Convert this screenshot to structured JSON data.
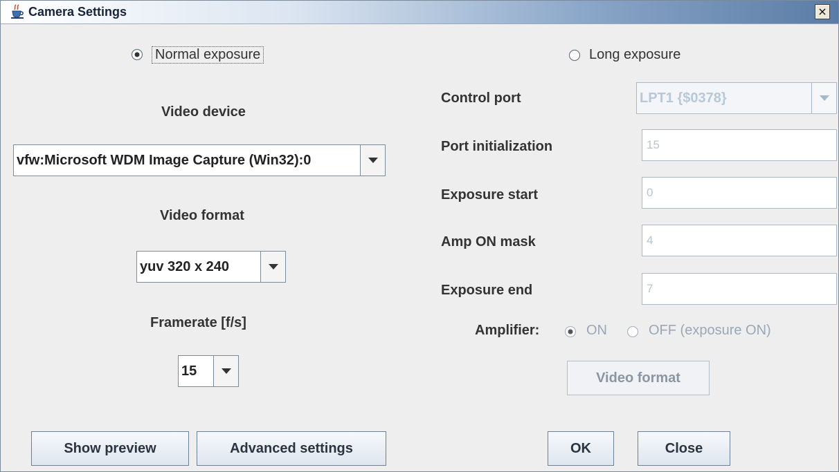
{
  "window": {
    "title": "Camera Settings",
    "close_glyph": "×",
    "icon": "java-cup-icon"
  },
  "exposure": {
    "normal_label": "Normal exposure",
    "long_label": "Long exposure",
    "selected": "normal"
  },
  "left": {
    "video_device_label": "Video device",
    "video_device_value": "vfw:Microsoft WDM Image Capture (Win32):0",
    "video_format_label": "Video format",
    "video_format_value": "yuv 320 x 240",
    "framerate_label": "Framerate [f/s]",
    "framerate_value": "15"
  },
  "right": {
    "control_port_label": "Control port",
    "control_port_value": "LPT1 {$0378}",
    "port_init_label": "Port initialization",
    "port_init_value": "15",
    "exposure_start_label": "Exposure start",
    "exposure_start_value": "0",
    "amp_on_mask_label": "Amp ON mask",
    "amp_on_mask_value": "4",
    "exposure_end_label": "Exposure end",
    "exposure_end_value": "7",
    "amplifier_label": "Amplifier:",
    "amp_on_label": "ON",
    "amp_off_label": "OFF (exposure ON)",
    "amplifier_selected": "on",
    "video_format_button": "Video format"
  },
  "buttons": {
    "show_preview": "Show preview",
    "advanced_settings": "Advanced settings",
    "ok": "OK",
    "close": "Close"
  },
  "colors": {
    "title_gradient_end": "#5a7ca6",
    "disabled_text": "#9aa7b6",
    "background": "#eeeeee"
  }
}
